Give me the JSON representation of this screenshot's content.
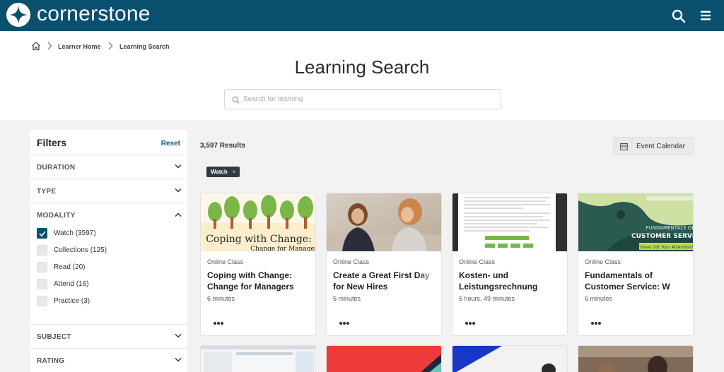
{
  "brand": {
    "name": "cornerstone"
  },
  "breadcrumb": [
    "Learner Home",
    "Learning Search"
  ],
  "page": {
    "title": "Learning Search",
    "search_placeholder": "Search for learning"
  },
  "filters": {
    "title": "Filters",
    "reset": "Reset",
    "sections": {
      "duration": "DURATION",
      "type": "TYPE",
      "modality": "MODALITY",
      "subject": "SUBJECT",
      "rating": "RATING"
    },
    "modality_options": [
      {
        "label": "Watch (3597)",
        "checked": true
      },
      {
        "label": "Collections (125)",
        "checked": false
      },
      {
        "label": "Read (20)",
        "checked": false
      },
      {
        "label": "Attend (16)",
        "checked": false
      },
      {
        "label": "Practice (3)",
        "checked": false
      }
    ]
  },
  "results": {
    "count": "3,597 Results",
    "event_calendar": "Event Calendar",
    "active_chip": "Watch",
    "chip_remove": "×"
  },
  "cards": [
    {
      "type": "Online Class",
      "title": "Coping with Change: Change for Managers",
      "duration": "6 minutes",
      "thumb_caption_1": "Coping with Change:",
      "thumb_caption_2": "Change for Managers"
    },
    {
      "type": "Online Class",
      "title": "Create a Great First Day for New Hires",
      "duration": "5 minutes"
    },
    {
      "type": "Online Class",
      "title": "Kosten- und Leistungsrechnung",
      "duration": "5 hours, 49 minutes"
    },
    {
      "type": "Online Class",
      "title": "Fundamentals of Customer Service: W",
      "duration": "6 minutes",
      "thumb_caption_1": "FUNDAMENTALS OF",
      "thumb_caption_2": "CUSTOMER SERVICE",
      "thumb_caption_3": "Have Got Your Attention?"
    }
  ],
  "colors": {
    "topbar": "#09506f",
    "accent": "#0a5a7e",
    "chip": "#303a44"
  },
  "icons": {
    "logo": "compass-star-logo-icon",
    "search": "search-icon",
    "menu": "hamburger-menu-icon",
    "home": "home-icon",
    "calendar": "calendar-icon",
    "more": "ellipsis-icon"
  }
}
